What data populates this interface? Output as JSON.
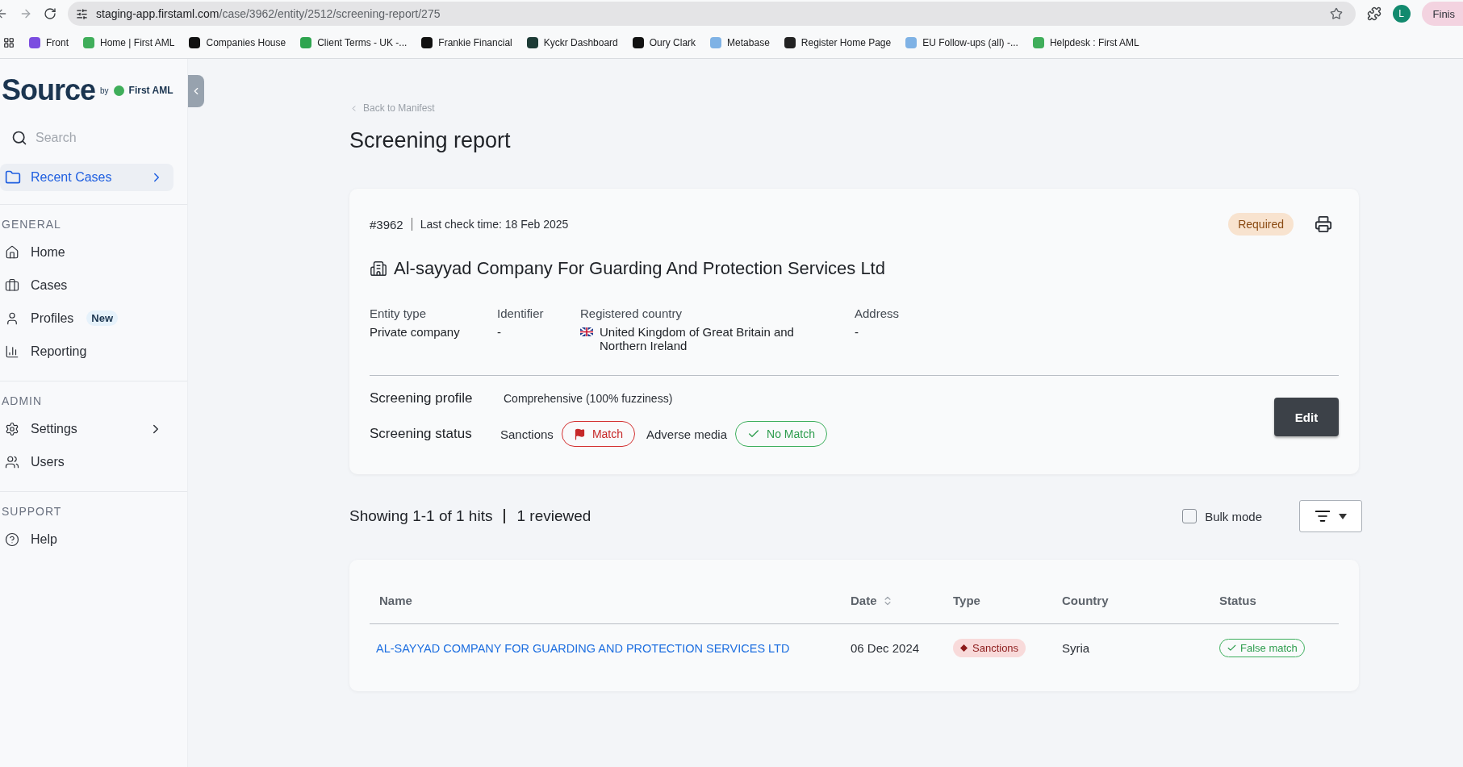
{
  "browser": {
    "url_host": "staging-app.firstaml.com",
    "url_path": "/case/3962/entity/2512/screening-report/275",
    "profile_initial": "L",
    "profile_button": "Finis",
    "bookmarks": [
      {
        "label": "Front",
        "color": "#7b4de0"
      },
      {
        "label": "Home | First AML",
        "color": "#3fae5a"
      },
      {
        "label": "Companies House",
        "color": "#111111"
      },
      {
        "label": "Client Terms - UK -...",
        "color": "#2ea44f"
      },
      {
        "label": "Frankie Financial",
        "color": "#111111"
      },
      {
        "label": "Kyckr Dashboard",
        "color": "#1d3b36"
      },
      {
        "label": "Oury Clark",
        "color": "#111111"
      },
      {
        "label": "Metabase",
        "color": "#7fb2e5"
      },
      {
        "label": "Register Home Page",
        "color": "#222222"
      },
      {
        "label": "EU Follow-ups (all) -...",
        "color": "#7fb2e5"
      },
      {
        "label": "Helpdesk : First AML",
        "color": "#3fae5a"
      }
    ]
  },
  "sidebar": {
    "logo": "Source",
    "logo_by": "by",
    "logo_brand": "First AML",
    "search_placeholder": "Search",
    "recent": {
      "label": "Recent Cases",
      "selected": true
    },
    "sections": [
      {
        "title": "GENERAL",
        "items": [
          {
            "label": "Home",
            "expandable": false
          },
          {
            "label": "Cases",
            "expandable": false
          },
          {
            "label": "Profiles",
            "badge": "New",
            "expandable": false
          },
          {
            "label": "Reporting",
            "expandable": false
          }
        ]
      },
      {
        "title": "ADMIN",
        "items": [
          {
            "label": "Settings",
            "expandable": true
          },
          {
            "label": "Users",
            "expandable": false
          }
        ]
      },
      {
        "title": "SUPPORT",
        "items": [
          {
            "label": "Help",
            "expandable": false
          }
        ]
      }
    ]
  },
  "page": {
    "back_link": "Back to Manifest",
    "title": "Screening report",
    "report": {
      "case_id": "#3962",
      "last_check": "Last check time: 18 Feb 2025",
      "status_badge": "Required",
      "entity_name": "Al-sayyad Company For Guarding And Protection Services Ltd",
      "fields": [
        {
          "label": "Entity type",
          "value": "Private company",
          "flag": false
        },
        {
          "label": "Identifier",
          "value": "-",
          "flag": false
        },
        {
          "label": "Registered country",
          "value": "United Kingdom of Great Britain and Northern Ireland",
          "flag": true
        },
        {
          "label": "Address",
          "value": "-",
          "flag": false
        }
      ],
      "profile_label": "Screening profile",
      "profile_value": "Comprehensive (100% fuzziness)",
      "status_label": "Screening status",
      "checks": [
        {
          "label": "Sanctions",
          "result": "Match",
          "matched": true
        },
        {
          "label": "Adverse media",
          "result": "No Match",
          "matched": false
        }
      ],
      "edit_button": "Edit"
    },
    "hits": {
      "summary": "Showing 1-1 of 1 hits",
      "reviewed": "1 reviewed",
      "bulk_mode": {
        "label": "Bulk mode",
        "checked": false
      }
    },
    "table": {
      "columns": [
        {
          "label": "Name",
          "sortable": false
        },
        {
          "label": "Date",
          "sortable": true
        },
        {
          "label": "Type",
          "sortable": false
        },
        {
          "label": "Country",
          "sortable": false
        },
        {
          "label": "Status",
          "sortable": false
        }
      ],
      "rows": [
        {
          "name": "AL-SAYYAD COMPANY FOR GUARDING AND PROTECTION SERVICES LTD",
          "date": "06 Dec 2024",
          "type": "Sanctions",
          "country": "Syria",
          "status": "False match"
        }
      ]
    }
  }
}
